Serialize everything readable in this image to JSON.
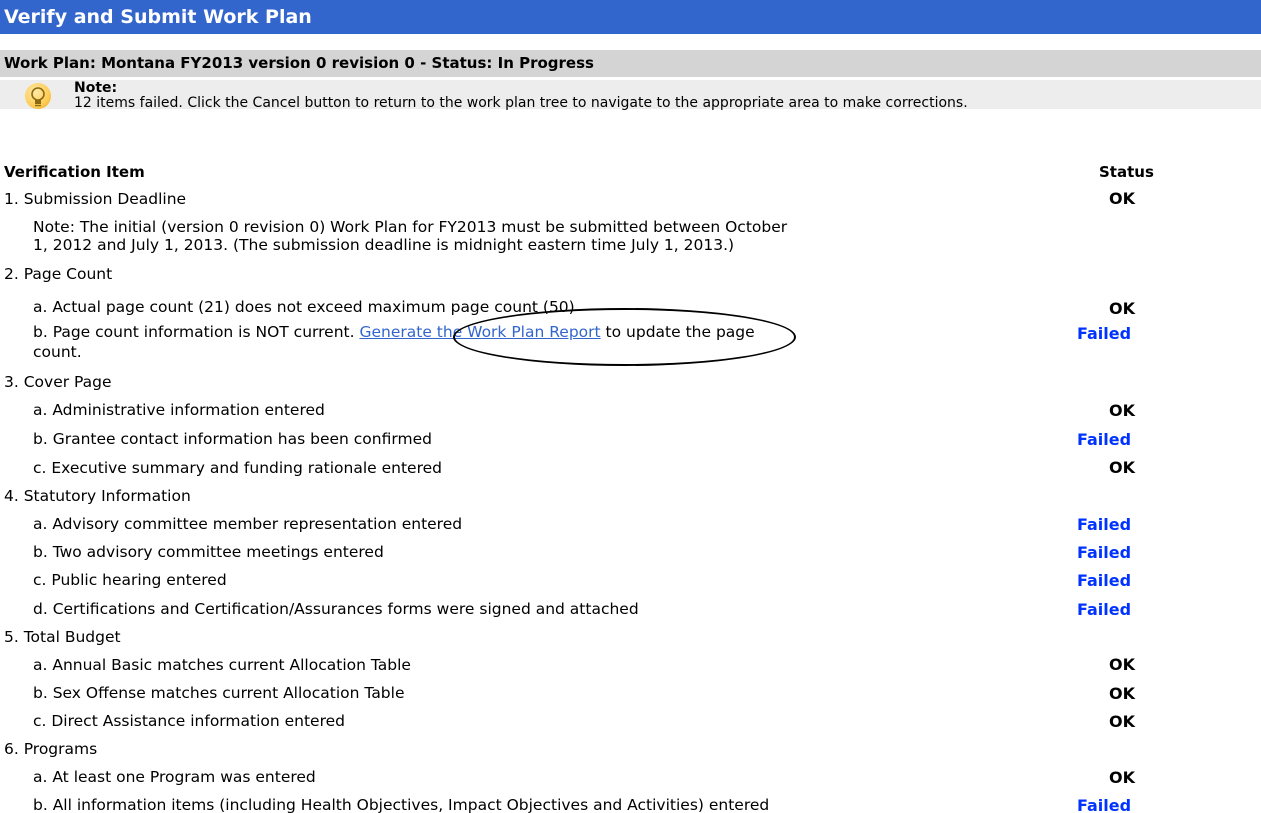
{
  "title": "Verify and Submit Work Plan",
  "work_plan_header": "Work Plan: Montana FY2013 version 0 revision 0 - Status: In Progress",
  "note": {
    "icon": "lightbulb-icon",
    "title": "Note:",
    "text": "12 items failed. Click the Cancel button to return to the work plan tree to navigate to the appropriate area to make corrections."
  },
  "columns": {
    "item": "Verification Item",
    "status": "Status"
  },
  "colors": {
    "title_bar": "#3366cc",
    "failed": "#0033ff",
    "link": "#3366cc"
  },
  "sections": [
    {
      "label": "1. Submission Deadline",
      "status": "OK",
      "note_lines": [
        "Note: The initial (version 0 revision 0) Work Plan for FY2013 must be submitted between October",
        "1, 2012 and July 1, 2013. (The submission deadline is midnight eastern time July 1, 2013.)"
      ]
    },
    {
      "label": "2. Page Count",
      "items": [
        {
          "text": "a. Actual page count (21) does not exceed maximum page count (50)",
          "status": "OK"
        },
        {
          "text_before": "b. Page count information is NOT current. ",
          "link": "Generate the Work Plan Report",
          "text_after": " to update the page",
          "text_line2": "count.",
          "status": "Failed"
        }
      ]
    },
    {
      "label": "3. Cover Page",
      "items": [
        {
          "text": "a. Administrative information entered",
          "status": "OK"
        },
        {
          "text": "b. Grantee contact information has been confirmed",
          "status": "Failed"
        },
        {
          "text": "c. Executive summary and funding rationale entered",
          "status": "OK"
        }
      ]
    },
    {
      "label": "4. Statutory Information",
      "items": [
        {
          "text": "a. Advisory committee member representation entered",
          "status": "Failed"
        },
        {
          "text": "b. Two advisory committee meetings entered",
          "status": "Failed"
        },
        {
          "text": "c. Public hearing entered",
          "status": "Failed"
        },
        {
          "text": "d. Certifications and Certification/Assurances forms were signed and attached",
          "status": "Failed"
        }
      ]
    },
    {
      "label": "5. Total Budget",
      "items": [
        {
          "text": "a. Annual Basic matches current Allocation Table",
          "status": "OK"
        },
        {
          "text": "b. Sex Offense matches current Allocation Table",
          "status": "OK"
        },
        {
          "text": "c. Direct Assistance information entered",
          "status": "OK"
        }
      ]
    },
    {
      "label": "6. Programs",
      "items": [
        {
          "text": "a. At least one Program was entered",
          "status": "OK"
        },
        {
          "text": "b. All information items (including Health Objectives, Impact Objectives and Activities) entered",
          "status": "Failed"
        }
      ]
    }
  ]
}
